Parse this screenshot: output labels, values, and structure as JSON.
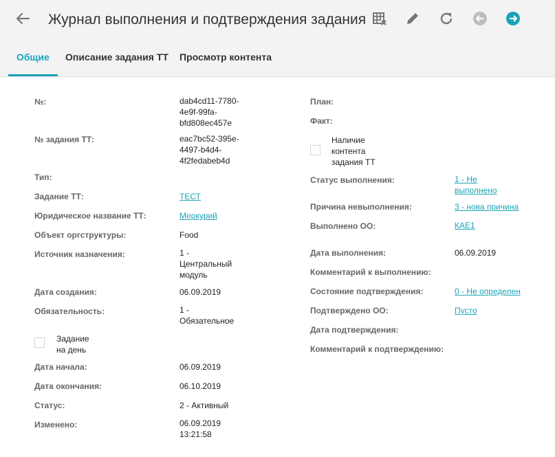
{
  "header": {
    "title": "Журнал выполнения и подтверждения задания",
    "accent": "#1aa3b8"
  },
  "tabs": [
    {
      "label": "Общие",
      "active": true
    },
    {
      "label": "Описание задания ТТ",
      "active": false
    },
    {
      "label": "Просмотр контента",
      "active": false
    }
  ],
  "left": {
    "number_label": "№:",
    "number_value": "dab4cd11-7780-4e9f-99fa-bfd808ec457e",
    "task_tt_label": "№ задания ТТ:",
    "task_tt_value": "eac7bc52-395e-4497-b4d4-4f2fedabeb4d",
    "type_label": "Тип:",
    "task_label": "Задание ТТ:",
    "task_value": "ТЕСТ",
    "legal_name_label": "Юридическое название ТТ:",
    "legal_name_value": "Меркурий",
    "org_object_label": "Объект оргструктуры:",
    "org_object_value": "Food",
    "source_label": "Источник назначения:",
    "source_value": "1 - Центральный модуль",
    "created_label": "Дата создания:",
    "created_value": "06.09.2019",
    "obligation_label": "Обязательность:",
    "obligation_value": "1 - Обязательное",
    "day_task_label": "Задание на день",
    "start_label": "Дата начала:",
    "start_value": "06.09.2019",
    "end_label": "Дата окончания:",
    "end_value": "06.10.2019",
    "status_label": "Статус:",
    "status_value": "2 - Активный",
    "changed_label": "Изменено:",
    "changed_value": "06.09.2019 13:21:58"
  },
  "right": {
    "plan_label": "План:",
    "fact_label": "Факт:",
    "content_label": "Наличие контента задания ТТ",
    "exec_status_label": "Статус выполнения:",
    "exec_status_value": "1 - Не выполнено",
    "reason_label": "Причина невыполнения:",
    "reason_value": "3 - нова причина",
    "done_oo_label": "Выполнено ОО:",
    "done_oo_value": "КАЕ1",
    "exec_date_label": "Дата выполнения:",
    "exec_date_value": "06.09.2019",
    "exec_comment_label": "Комментарий к выполнению:",
    "confirm_state_label": "Состояние подтверждения:",
    "confirm_state_value": "0 - Не определен",
    "confirmed_oo_label": "Подтверждено ОО:",
    "confirmed_oo_value": "Пусто",
    "confirm_date_label": "Дата подтверждения:",
    "confirm_comment_label": "Комментарий к подтверждению:"
  }
}
